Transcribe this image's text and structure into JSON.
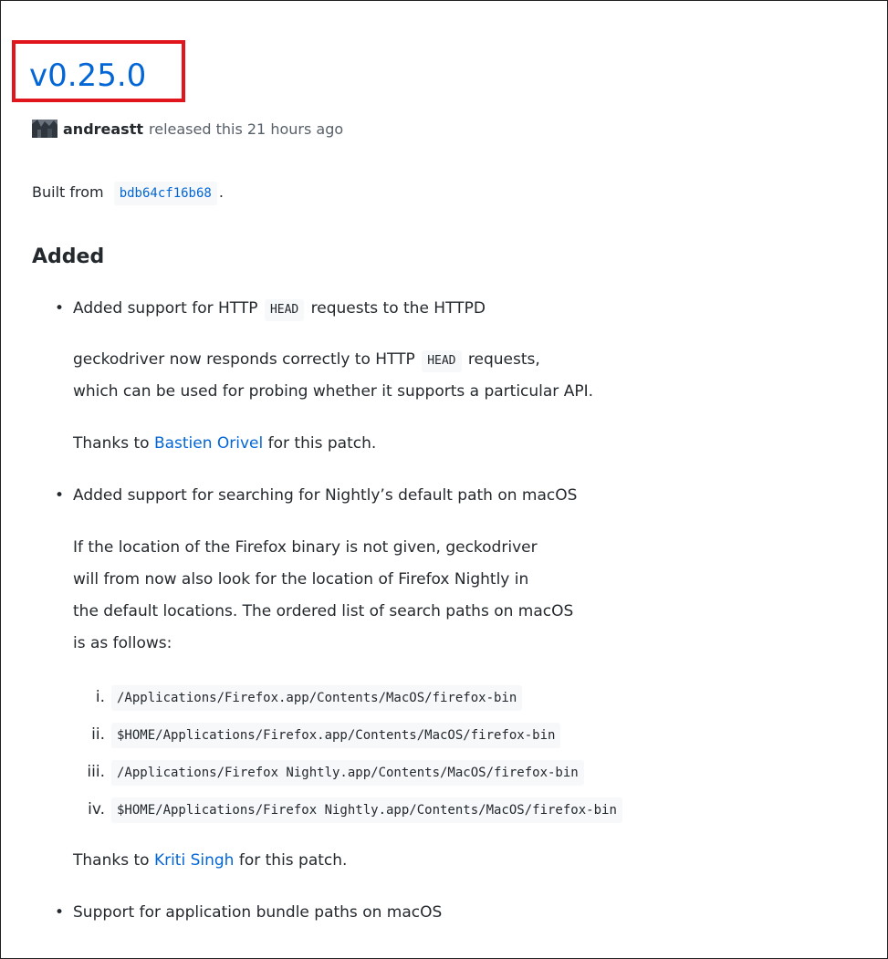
{
  "release": {
    "title": "v0.25.0",
    "author": "andreastt",
    "released_text": "released this 21 hours ago",
    "built_from_prefix": "Built from",
    "commit": "bdb64cf16b68",
    "built_from_suffix": "."
  },
  "section": {
    "heading": "Added"
  },
  "items": {
    "item1": {
      "bullet_before": "Added support for HTTP",
      "bullet_code": "HEAD",
      "bullet_after": "requests to the HTTPD",
      "p1_line1_before": "geckodriver now responds correctly to HTTP",
      "p1_line1_code": "HEAD",
      "p1_line1_after": "requests,",
      "p1_line2": "which can be used for probing whether it supports a particular API.",
      "thanks_prefix": "Thanks to",
      "thanks_name": "Bastien Orivel",
      "thanks_suffix": "for this patch."
    },
    "item2": {
      "bullet": "Added support for searching for Nightly’s default path on macOS",
      "p_lines": [
        "If the location of the Firefox binary is not given, geckodriver",
        "will from now also look for the location of Firefox Nightly in",
        "the default locations. The ordered list of search paths on macOS",
        "is as follows:"
      ],
      "paths": [
        {
          "numeral": "i.",
          "path": "/Applications/Firefox.app/Contents/MacOS/firefox-bin"
        },
        {
          "numeral": "ii.",
          "path": "$HOME/Applications/Firefox.app/Contents/MacOS/firefox-bin"
        },
        {
          "numeral": "iii.",
          "path": "/Applications/Firefox Nightly.app/Contents/MacOS/firefox-bin"
        },
        {
          "numeral": "iv.",
          "path": "$HOME/Applications/Firefox Nightly.app/Contents/MacOS/firefox-bin"
        }
      ],
      "thanks_prefix": "Thanks to",
      "thanks_name": "Kriti Singh",
      "thanks_suffix": "for this patch."
    },
    "item3": {
      "bullet": "Support for application bundle paths on macOS"
    }
  },
  "colors": {
    "link": "#0366d6",
    "highlight_box": "#e0161c",
    "code_background": "#f6f8fa"
  }
}
